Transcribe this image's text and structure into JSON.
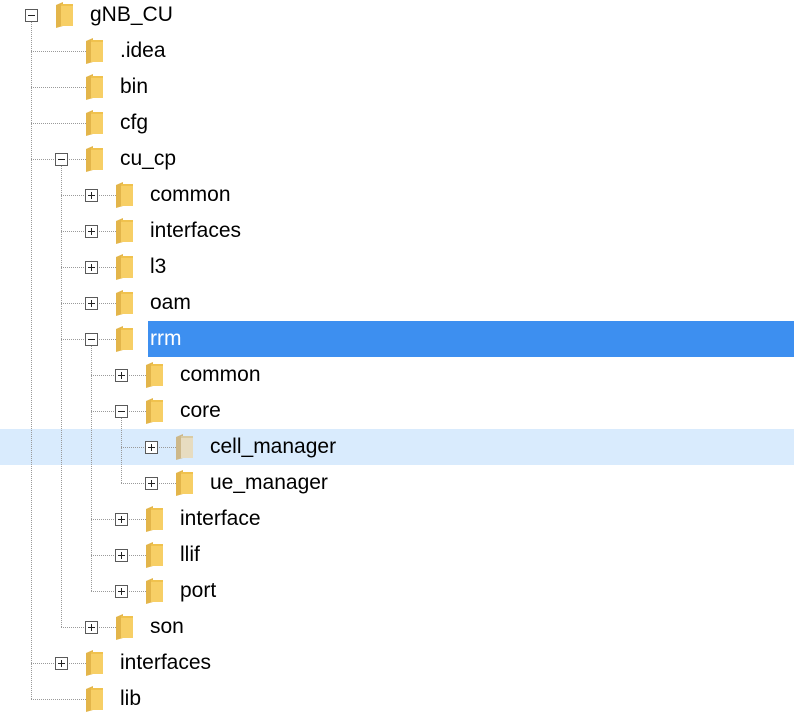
{
  "tree": {
    "colors": {
      "selected_bg": "#3d8ff0",
      "selected_text": "#ffffff",
      "hover_bg": "#d9ebfd",
      "folder": "#f7cf66"
    },
    "nodes": [
      {
        "label": "gNB_CU",
        "level": 0,
        "toggle": "expanded",
        "icon": "folder-icon",
        "state": ""
      },
      {
        "label": ".idea",
        "level": 1,
        "toggle": "none",
        "icon": "folder-icon",
        "state": ""
      },
      {
        "label": "bin",
        "level": 1,
        "toggle": "none",
        "icon": "folder-icon",
        "state": ""
      },
      {
        "label": "cfg",
        "level": 1,
        "toggle": "none",
        "icon": "folder-icon",
        "state": ""
      },
      {
        "label": "cu_cp",
        "level": 1,
        "toggle": "expanded",
        "icon": "folder-icon",
        "state": ""
      },
      {
        "label": "common",
        "level": 2,
        "toggle": "collapsed",
        "icon": "folder-icon",
        "state": ""
      },
      {
        "label": "interfaces",
        "level": 2,
        "toggle": "collapsed",
        "icon": "folder-icon",
        "state": ""
      },
      {
        "label": "l3",
        "level": 2,
        "toggle": "collapsed",
        "icon": "folder-icon",
        "state": ""
      },
      {
        "label": "oam",
        "level": 2,
        "toggle": "collapsed",
        "icon": "folder-icon",
        "state": ""
      },
      {
        "label": "rrm",
        "level": 2,
        "toggle": "expanded",
        "icon": "folder-icon",
        "state": "selected"
      },
      {
        "label": "common",
        "level": 3,
        "toggle": "collapsed",
        "icon": "folder-icon",
        "state": ""
      },
      {
        "label": "core",
        "level": 3,
        "toggle": "expanded",
        "icon": "folder-icon",
        "state": ""
      },
      {
        "label": "cell_manager",
        "level": 4,
        "toggle": "collapsed",
        "icon": "folder-icon",
        "state": "hover"
      },
      {
        "label": "ue_manager",
        "level": 4,
        "toggle": "collapsed",
        "icon": "folder-icon",
        "state": ""
      },
      {
        "label": "interface",
        "level": 3,
        "toggle": "collapsed",
        "icon": "folder-icon",
        "state": ""
      },
      {
        "label": "llif",
        "level": 3,
        "toggle": "collapsed",
        "icon": "folder-icon",
        "state": ""
      },
      {
        "label": "port",
        "level": 3,
        "toggle": "collapsed",
        "icon": "folder-icon",
        "state": ""
      },
      {
        "label": "son",
        "level": 2,
        "toggle": "collapsed",
        "icon": "folder-icon",
        "state": ""
      },
      {
        "label": "interfaces",
        "level": 1,
        "toggle": "collapsed",
        "icon": "folder-icon",
        "state": ""
      },
      {
        "label": "lib",
        "level": 1,
        "toggle": "none",
        "icon": "folder-icon",
        "state": ""
      }
    ]
  }
}
